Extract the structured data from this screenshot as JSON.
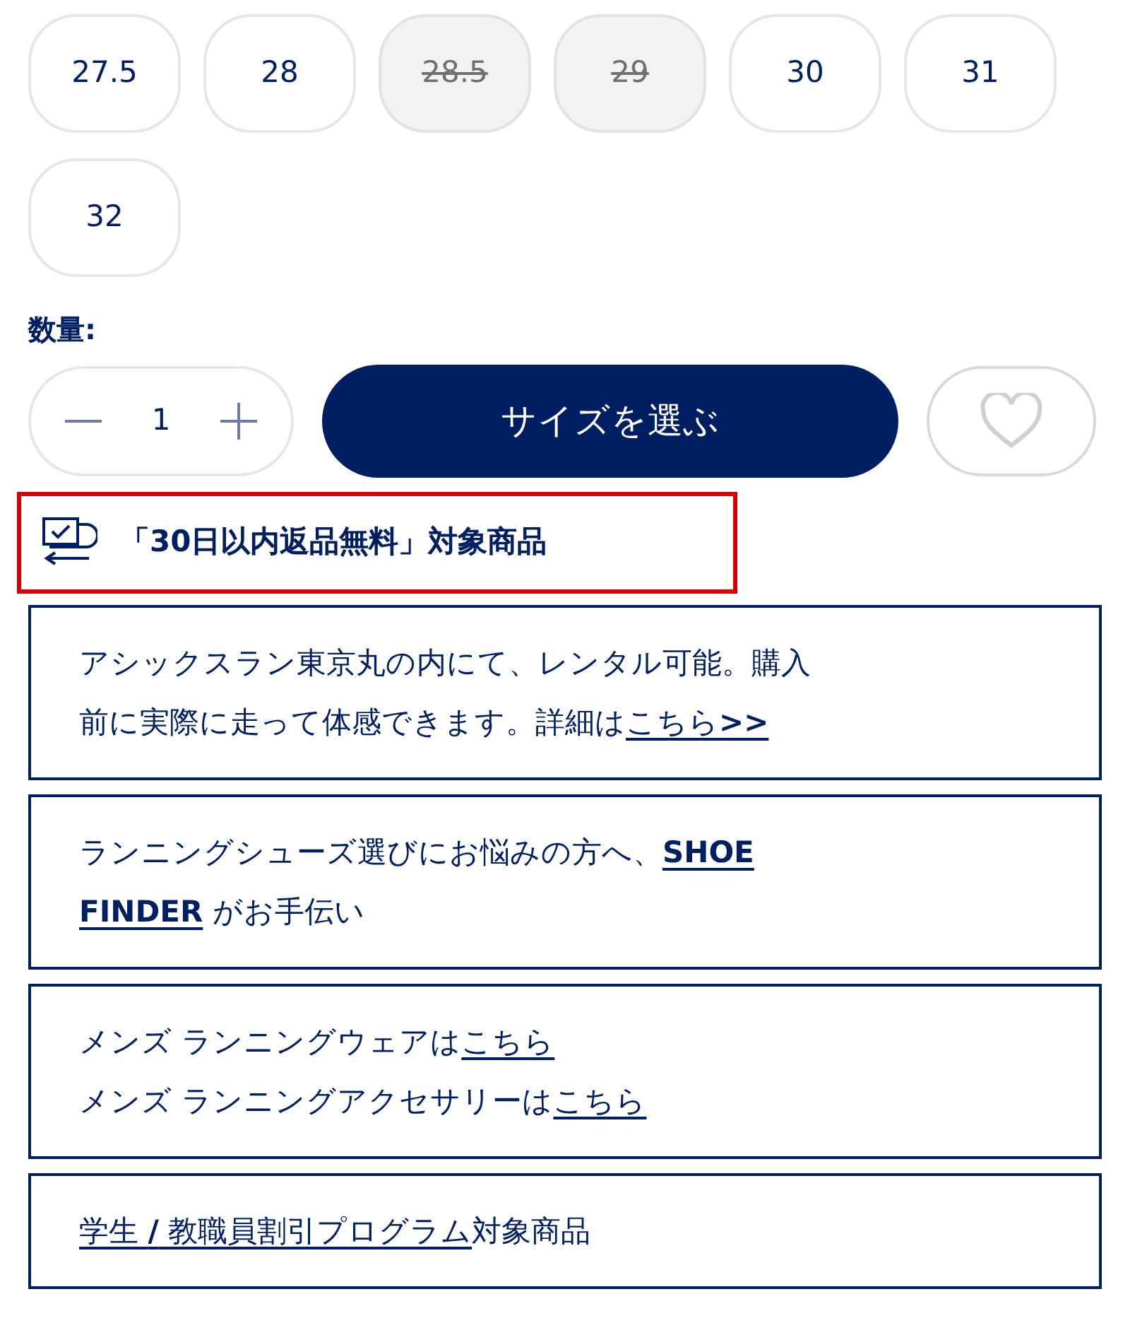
{
  "sizes": [
    {
      "label": "27.5",
      "disabled": false
    },
    {
      "label": "28",
      "disabled": false
    },
    {
      "label": "28.5",
      "disabled": true
    },
    {
      "label": "29",
      "disabled": true
    },
    {
      "label": "30",
      "disabled": false
    },
    {
      "label": "31",
      "disabled": false
    },
    {
      "label": "32",
      "disabled": false
    }
  ],
  "quantity": {
    "label": "数量:",
    "value": "1"
  },
  "select_button": "サイズを選ぶ",
  "return_notice": {
    "text": "「30日以内返品無料」対象商品",
    "highlighted": true
  },
  "info_boxes": [
    {
      "lines": [
        [
          {
            "text": "アシックスラン東京丸の内にて、レンタル可能。購入",
            "kind": "text"
          }
        ],
        [
          {
            "text": "前に実際に走って体感できます。詳細は",
            "kind": "text"
          },
          {
            "text": "こちら**>>**",
            "kind": "link"
          }
        ]
      ]
    },
    {
      "lines": [
        [
          {
            "text": "ランニングシューズ選びにお悩みの方へ、",
            "kind": "text"
          },
          {
            "text": "**SHOE**",
            "kind": "link"
          }
        ],
        [
          {
            "text": "**FINDER**",
            "kind": "link"
          },
          {
            "text": " がお手伝い",
            "kind": "text"
          }
        ]
      ]
    },
    {
      "lines": [
        [
          {
            "text": "メンズ ランニングウェアは",
            "kind": "text"
          },
          {
            "text": "こちら",
            "kind": "link"
          }
        ],
        [
          {
            "text": "メンズ ランニングアクセサリーは",
            "kind": "text"
          },
          {
            "text": "こちら",
            "kind": "link"
          }
        ]
      ]
    },
    {
      "lines": [
        [
          {
            "text": "学生 **/** 教職員割引プログラム",
            "kind": "link"
          },
          {
            "text": "対象商品",
            "kind": "text"
          }
        ]
      ]
    }
  ]
}
